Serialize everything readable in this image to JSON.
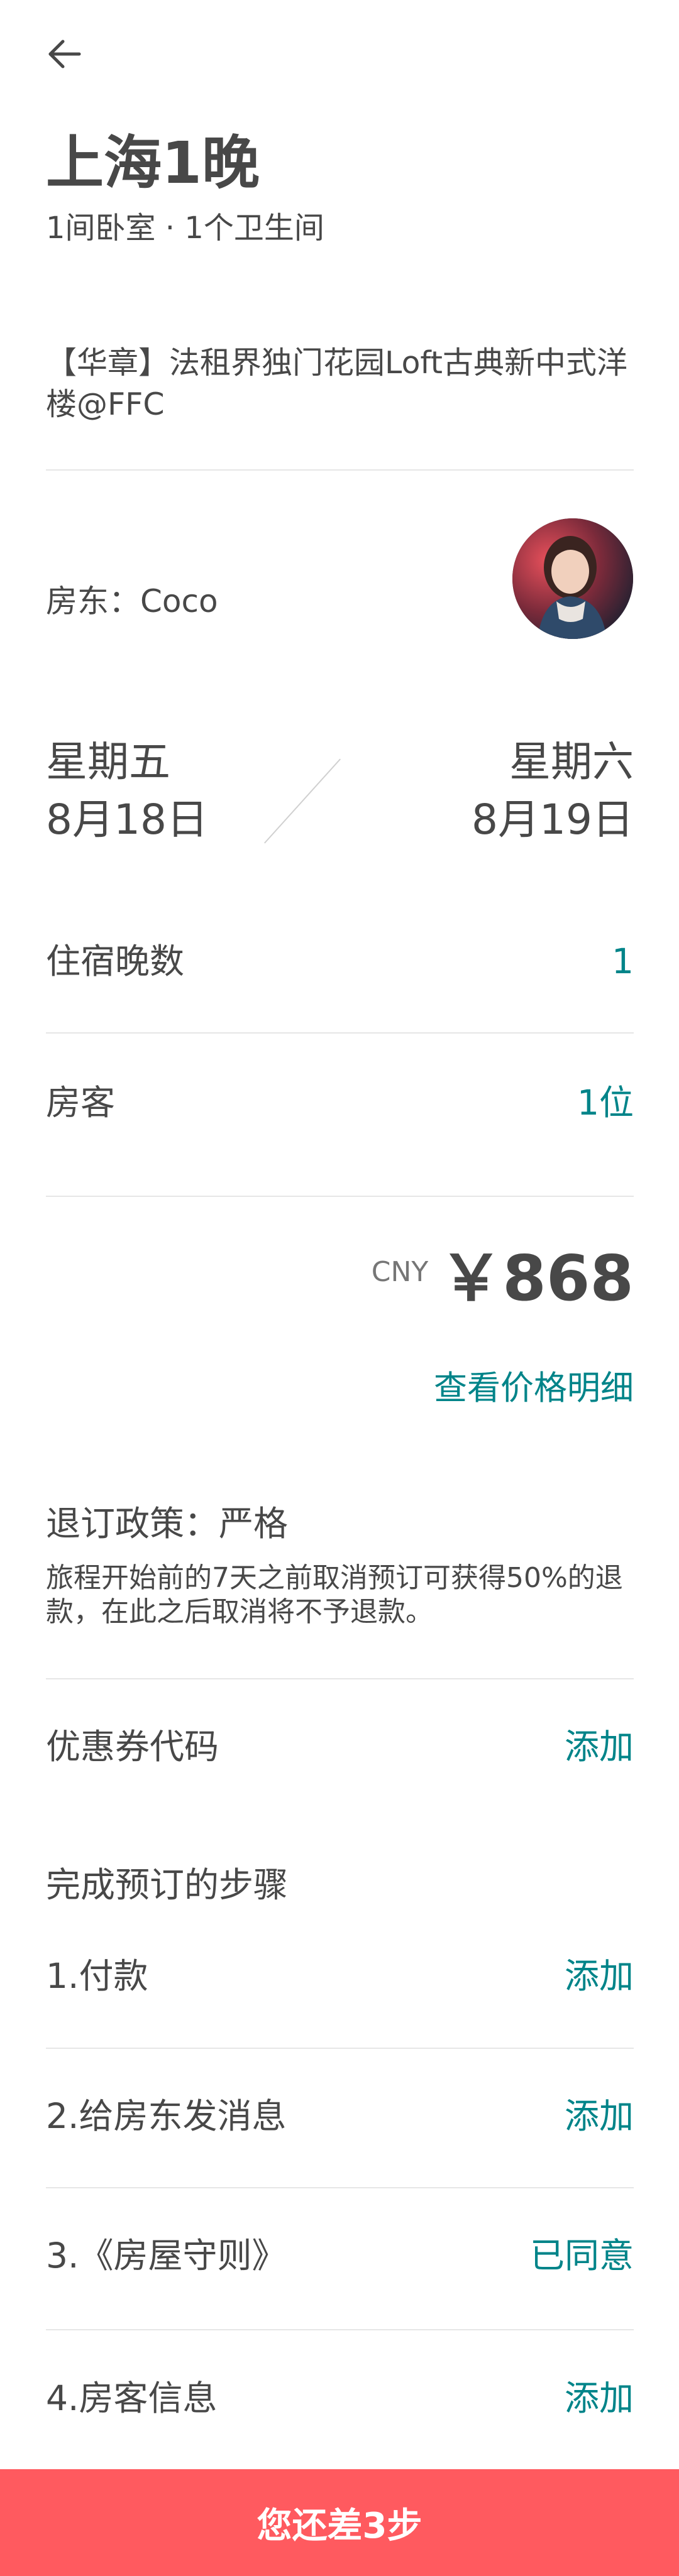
{
  "header": {
    "back_icon": "arrow-left-icon",
    "title": "上海1晚",
    "subtitle": "1间卧室 · 1个卫生间"
  },
  "listing": {
    "name": "【华章】法租界独门花园Loft古典新中式洋楼@FFC"
  },
  "host": {
    "label": "房东：Coco",
    "avatar_icon": "host-avatar"
  },
  "dates": {
    "checkin_day": "星期五",
    "checkin_date": "8月18日",
    "checkout_day": "星期六",
    "checkout_date": "8月19日"
  },
  "summary": {
    "nights_label": "住宿晚数",
    "nights_value": "1",
    "guests_label": "房客",
    "guests_value": "1位"
  },
  "price": {
    "currency": "CNY",
    "amount": "￥868",
    "details_link": "查看价格明细"
  },
  "policy": {
    "title": "退订政策：严格",
    "description": "旅程开始前的7天之前取消预订可获得50%的退款，在此之后取消将不予退款。"
  },
  "coupon": {
    "label": "优惠券代码",
    "action": "添加"
  },
  "steps": {
    "title": "完成预订的步骤",
    "items": [
      {
        "label": "1.付款",
        "action": "添加"
      },
      {
        "label": "2.给房东发消息",
        "action": "添加"
      },
      {
        "label": "3.《房屋守则》",
        "action": "已同意"
      },
      {
        "label": "4.房客信息",
        "action": "添加"
      }
    ]
  },
  "footer": {
    "cta": "您还差3步"
  },
  "colors": {
    "accent": "#008489",
    "cta": "#ff5a5f",
    "text": "#484848",
    "divider": "#e6e6e6"
  }
}
